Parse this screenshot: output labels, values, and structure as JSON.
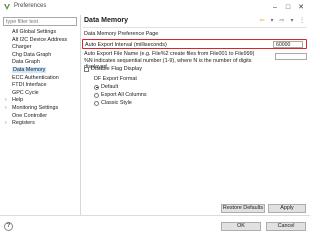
{
  "window": {
    "title": "Preferences",
    "controls": {
      "minimize": "–",
      "maximize": "□",
      "close": "✕"
    }
  },
  "sidebar": {
    "filter_placeholder": "type filter text",
    "items": [
      {
        "label": "All Global Settings",
        "expandable": false
      },
      {
        "label": "Alt I2C Device Address",
        "expandable": false
      },
      {
        "label": "Charger",
        "expandable": false
      },
      {
        "label": "Chg Data Graph",
        "expandable": false
      },
      {
        "label": "Data Graph",
        "expandable": false
      },
      {
        "label": "Data Memory",
        "expandable": false,
        "selected": true
      },
      {
        "label": "ECC Authentication",
        "expandable": false
      },
      {
        "label": "FTDI Interface",
        "expandable": false
      },
      {
        "label": "GPC Cycle",
        "expandable": false
      },
      {
        "label": "Help",
        "expandable": true
      },
      {
        "label": "Monitoring Settings",
        "expandable": true
      },
      {
        "label": "One Controller",
        "expandable": false
      },
      {
        "label": "Registers",
        "expandable": true
      }
    ]
  },
  "page": {
    "title": "Data Memory",
    "description": "Data Memory Preference Page",
    "auto_export_interval_label": "Auto Export Interval (milliseconds)",
    "auto_export_interval_value": "60000",
    "auto_export_filename_label_1": "Auto Export File Name (e.g. File%2 create files from File001 to File999)",
    "auto_export_filename_label_2": "%N indicates sequential number (1-9), where N is the number of digits displayed",
    "auto_export_filename_value": "",
    "disable_flag_label": "Disable Flag Display",
    "df_export_format_title": "DF Export Format",
    "export_options": [
      {
        "label": "Default",
        "selected": true
      },
      {
        "label": "Export All Columns",
        "selected": false
      },
      {
        "label": "Classic Style",
        "selected": false
      }
    ]
  },
  "buttons": {
    "restore_defaults": "Restore Defaults",
    "apply": "Apply",
    "ok": "OK",
    "cancel": "Cancel",
    "help": "?"
  },
  "colors": {
    "highlight_border": "#d62828",
    "selection_bg": "#cce8ff",
    "app_icon": "#5b8c3a"
  }
}
